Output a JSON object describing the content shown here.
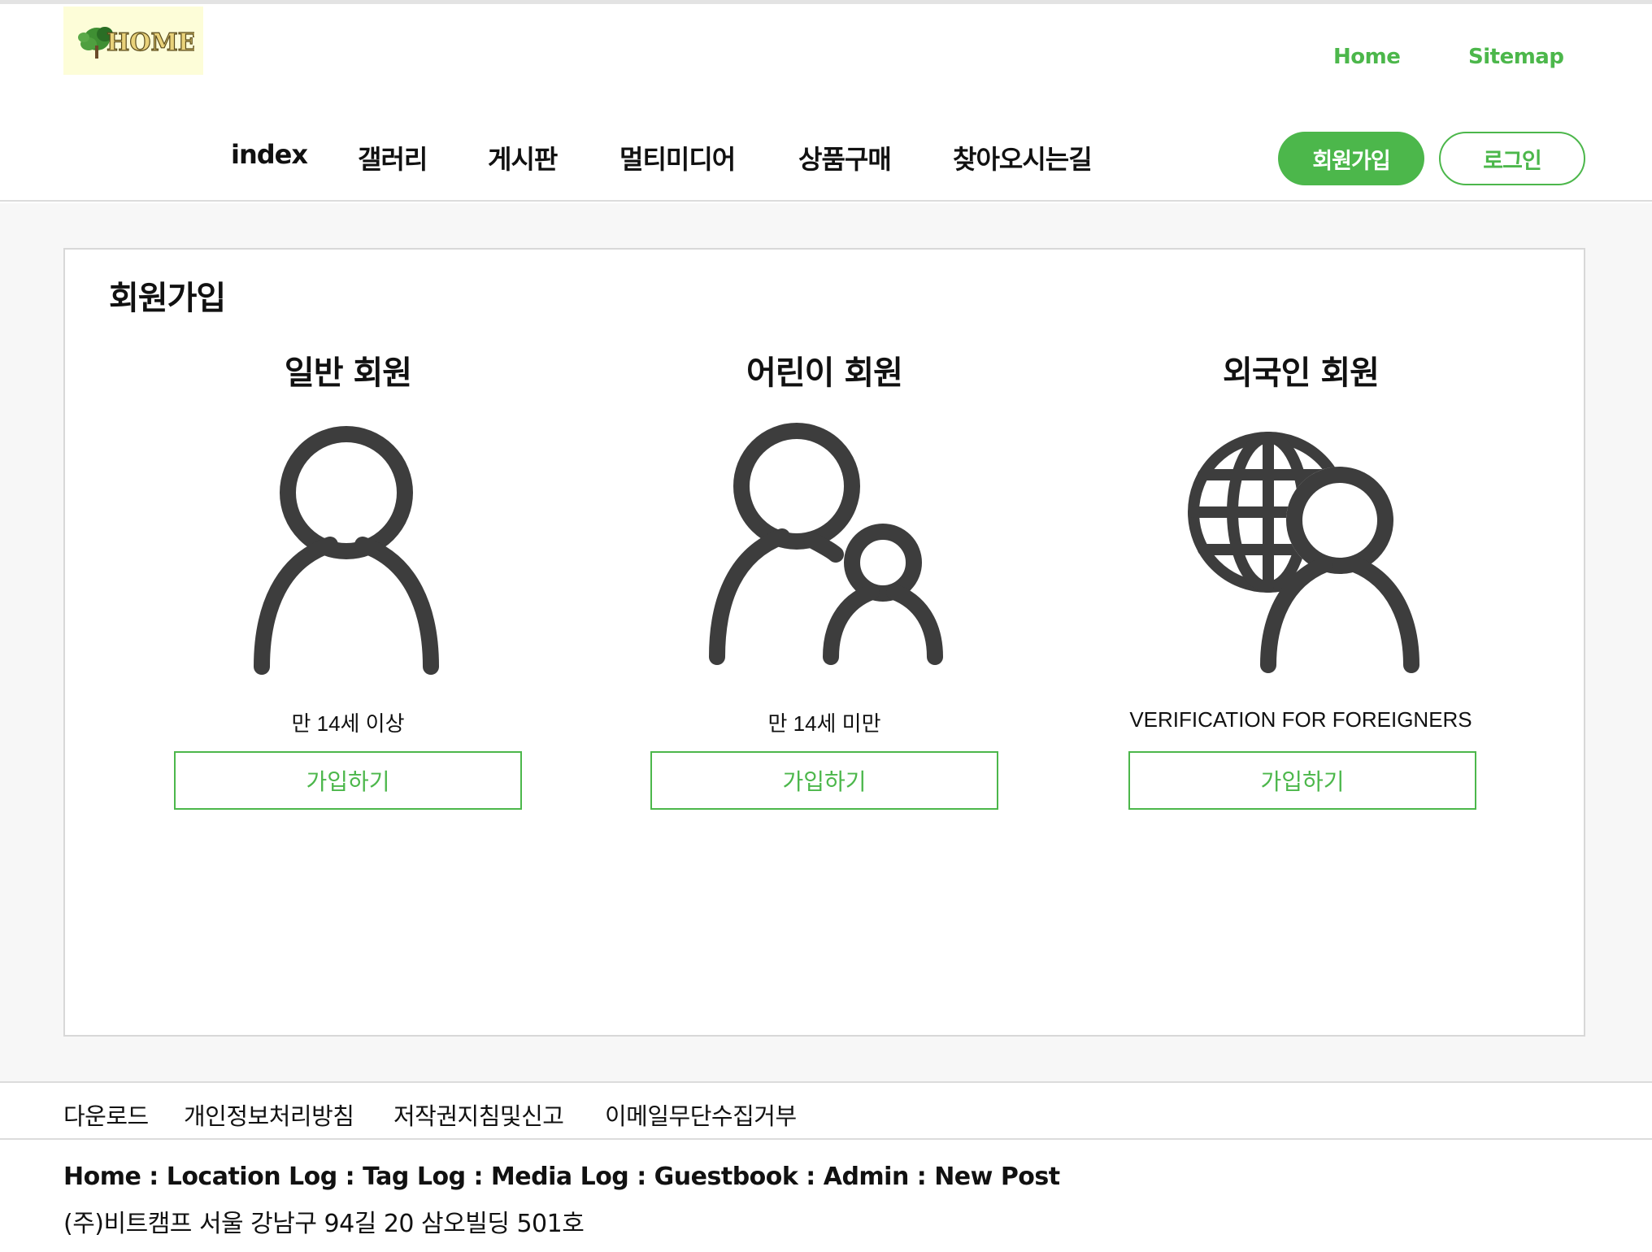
{
  "header": {
    "logo_alt": "Home",
    "util_links": [
      "Home",
      "Sitemap"
    ],
    "nav": [
      "index",
      "갤러리",
      "게시판",
      "멀티미디어",
      "상품구매",
      "찾아오시는길"
    ],
    "join_button": "회원가입",
    "login_button": "로그인"
  },
  "main": {
    "title": "회원가입",
    "columns": [
      {
        "title": "일반 회원",
        "icon": "person-icon",
        "desc": "만 14세 이상",
        "button": "가입하기"
      },
      {
        "title": "어린이 회원",
        "icon": "parent-child-icon",
        "desc": "만 14세 미만",
        "button": "가입하기"
      },
      {
        "title": "외국인 회원",
        "icon": "globe-person-icon",
        "desc": "VERIFICATION FOR FOREIGNERS",
        "button": "가입하기"
      }
    ]
  },
  "footer": {
    "links": [
      "다운로드",
      "개인정보처리방침",
      "저작권지침및신고",
      "이메일무단수집거부"
    ],
    "nav": "Home : Location Log : Tag Log : Media Log : Guestbook : Admin : New Post",
    "address": "(주)비트캠프 서울 강남구 94길 20 삼오빌딩 501호"
  },
  "colors": {
    "accent": "#4cb74b",
    "icon": "#3d3d3d",
    "page_bg": "#f7f7f7"
  }
}
